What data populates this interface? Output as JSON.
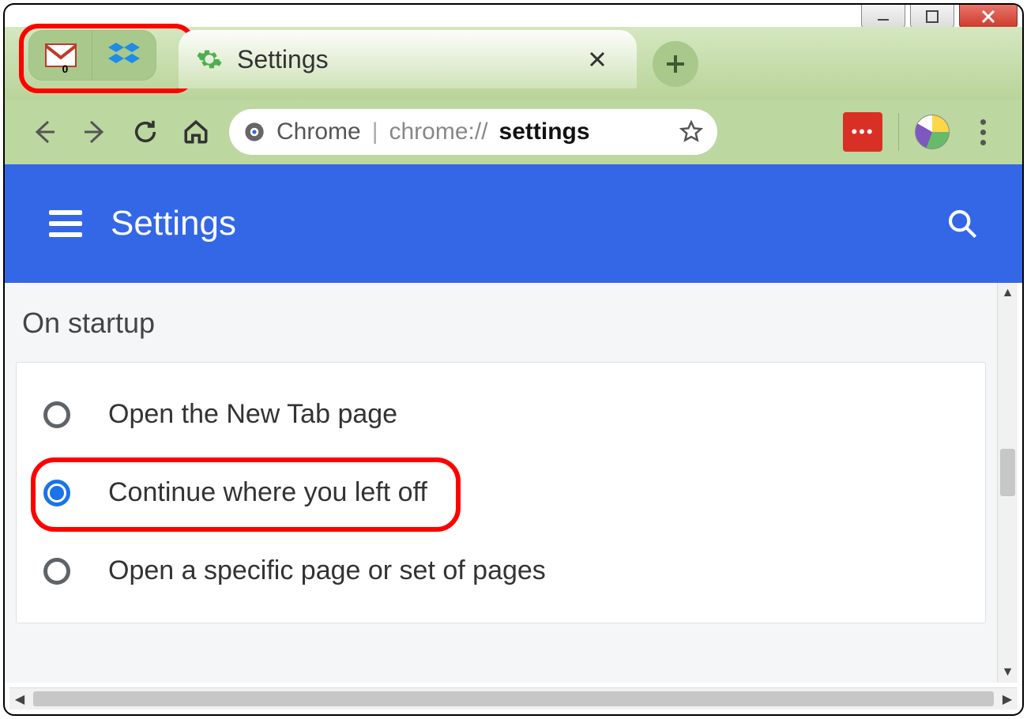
{
  "window_controls": {
    "minimize_name": "minimize",
    "maximize_name": "maximize",
    "close_name": "close"
  },
  "tabs": {
    "pinned": [
      {
        "name": "gmail-pinned-tab",
        "icon": "gmail-icon",
        "badge": "0"
      },
      {
        "name": "dropbox-pinned-tab",
        "icon": "dropbox-icon"
      }
    ],
    "active": {
      "title": "Settings",
      "icon": "settings-gear-icon"
    }
  },
  "toolbar": {
    "url_scheme_label": "Chrome",
    "url_host": "chrome://",
    "url_path": "settings"
  },
  "header": {
    "title": "Settings"
  },
  "startup": {
    "section_title": "On startup",
    "options": [
      {
        "label": "Open the New Tab page",
        "selected": false
      },
      {
        "label": "Continue where you left off",
        "selected": true
      },
      {
        "label": "Open a specific page or set of pages",
        "selected": false
      }
    ]
  },
  "colors": {
    "accent": "#3367e6",
    "radio_selected": "#1a73e8",
    "tabstrip": "#bcd7a0",
    "annotation": "#ff0000"
  }
}
